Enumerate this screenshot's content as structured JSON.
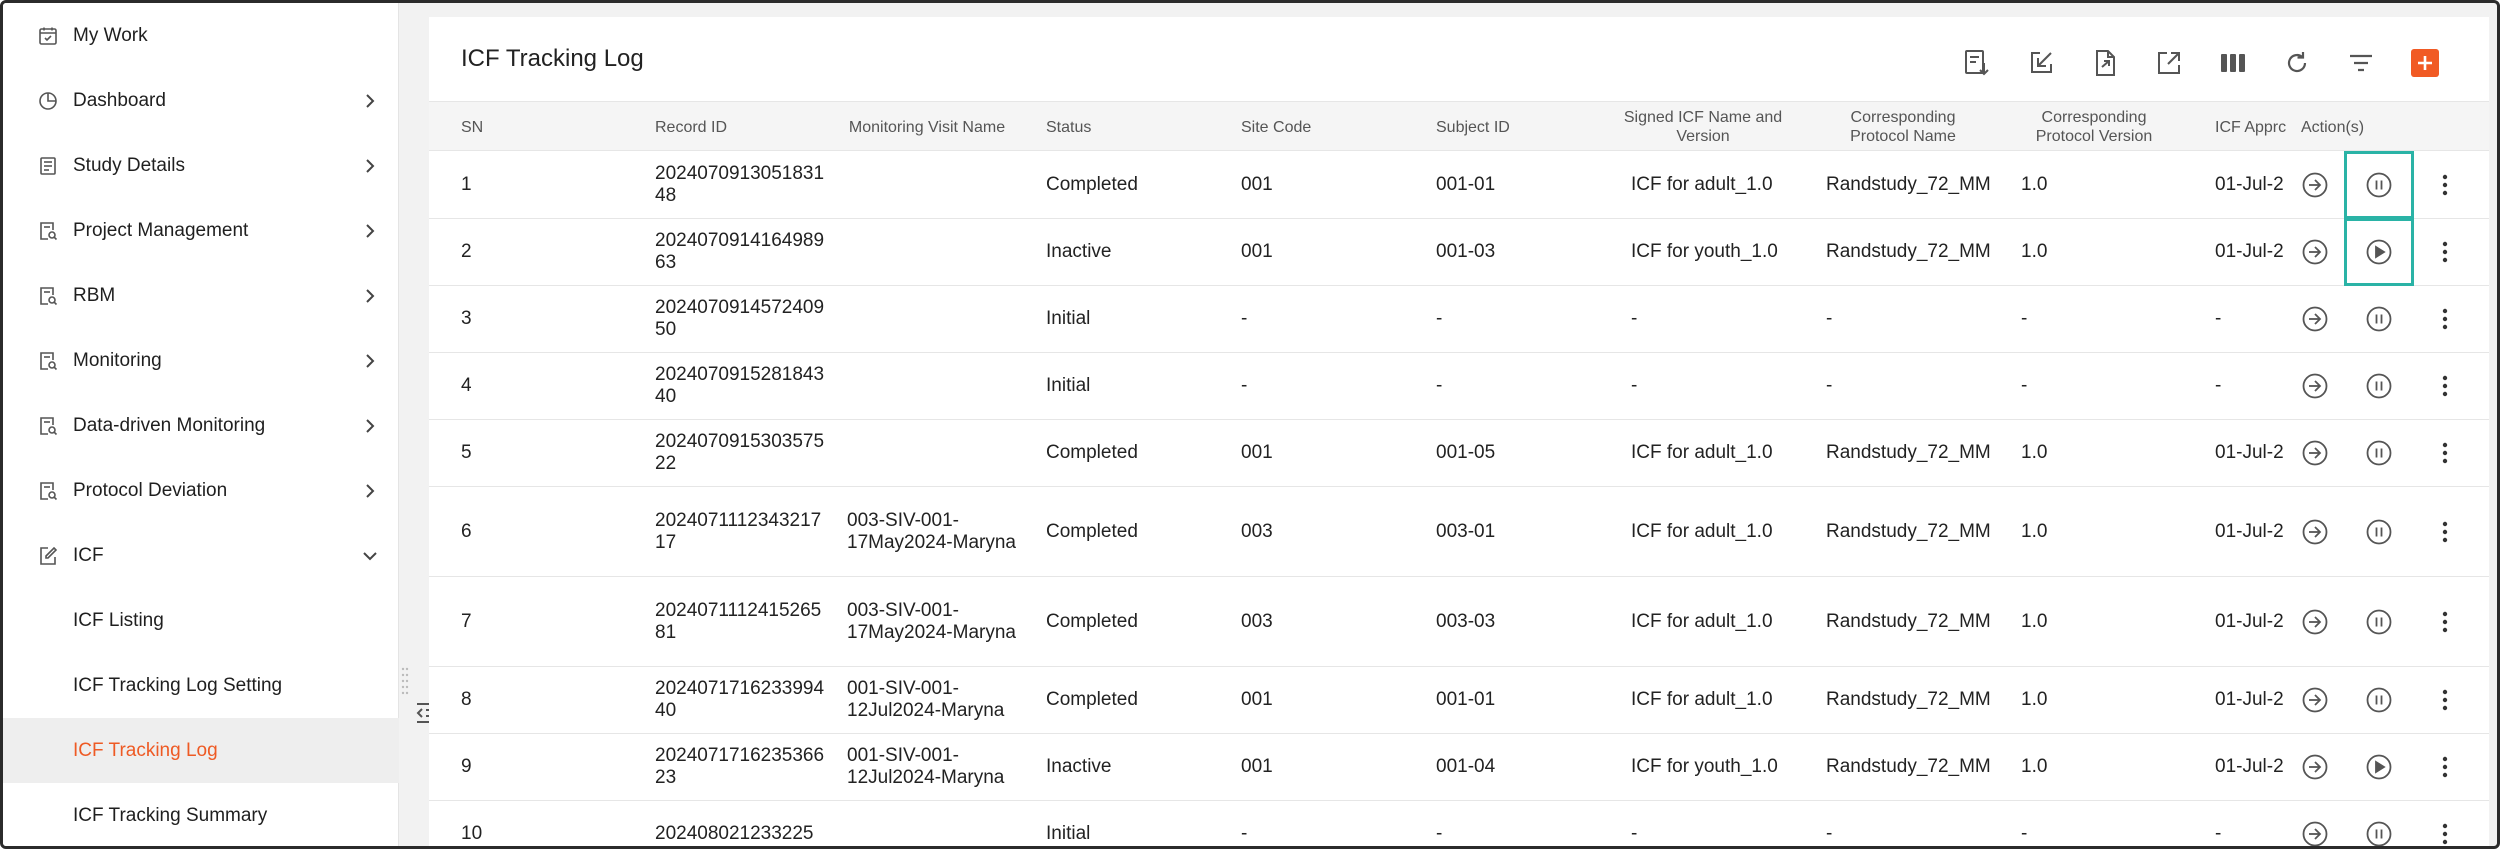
{
  "sidebar": {
    "items": [
      {
        "label": "My Work",
        "icon": "calendar-icon",
        "chevron": "none"
      },
      {
        "label": "Dashboard",
        "icon": "pie-chart-icon",
        "chevron": "right"
      },
      {
        "label": "Study Details",
        "icon": "document-list-icon",
        "chevron": "right"
      },
      {
        "label": "Project Management",
        "icon": "document-search-icon",
        "chevron": "right"
      },
      {
        "label": "RBM",
        "icon": "document-search-icon",
        "chevron": "right"
      },
      {
        "label": "Monitoring",
        "icon": "document-search-icon",
        "chevron": "right"
      },
      {
        "label": "Data-driven Monitoring",
        "icon": "document-search-icon",
        "chevron": "right"
      },
      {
        "label": "Protocol Deviation",
        "icon": "document-search-icon",
        "chevron": "right"
      },
      {
        "label": "ICF",
        "icon": "edit-document-icon",
        "chevron": "down"
      }
    ],
    "sub_items": [
      {
        "label": "ICF Listing",
        "active": false
      },
      {
        "label": "ICF Tracking Log Setting",
        "active": false
      },
      {
        "label": "ICF Tracking Log",
        "active": true
      },
      {
        "label": "ICF Tracking Summary",
        "active": false
      }
    ],
    "active_color": "#ee5a24"
  },
  "page": {
    "title": "ICF Tracking Log"
  },
  "toolbar": {
    "buttons": [
      "download-list-icon",
      "import-icon",
      "export-file-icon",
      "open-external-icon",
      "columns-icon",
      "refresh-icon",
      "filter-icon",
      "add-icon"
    ],
    "accent": "#f15a24"
  },
  "table": {
    "headers": {
      "sn": "SN",
      "record_id": "Record ID",
      "visit_name": "Monitoring Visit Name",
      "status": "Status",
      "site_code": "Site Code",
      "subject_id": "Subject ID",
      "icf_name": "Signed ICF Name and Version",
      "protocol_name": "Corresponding Protocol Name",
      "protocol_version": "Corresponding Protocol Version",
      "icf_approval": "ICF Apprc",
      "actions": "Action(s)"
    },
    "rows": [
      {
        "sn": "1",
        "record_id": "202407091305183148",
        "visit_name": "",
        "status": "Completed",
        "site_code": "001",
        "subject_id": "001-01",
        "icf_name": "ICF for adult_1.0",
        "protocol_name": "Randstudy_72_MM",
        "protocol_version": "1.0",
        "icf_approval": "01-Jul-2",
        "toggle": "pause"
      },
      {
        "sn": "2",
        "record_id": "202407091416498963",
        "visit_name": "",
        "status": "Inactive",
        "site_code": "001",
        "subject_id": "001-03",
        "icf_name": "ICF for youth_1.0",
        "protocol_name": "Randstudy_72_MM",
        "protocol_version": "1.0",
        "icf_approval": "01-Jul-2",
        "toggle": "play"
      },
      {
        "sn": "3",
        "record_id": "202407091457240950",
        "visit_name": "",
        "status": "Initial",
        "site_code": "-",
        "subject_id": "-",
        "icf_name": "-",
        "protocol_name": "-",
        "protocol_version": "-",
        "icf_approval": "-",
        "toggle": "pause"
      },
      {
        "sn": "4",
        "record_id": "202407091528184340",
        "visit_name": "",
        "status": "Initial",
        "site_code": "-",
        "subject_id": "-",
        "icf_name": "-",
        "protocol_name": "-",
        "protocol_version": "-",
        "icf_approval": "-",
        "toggle": "pause"
      },
      {
        "sn": "5",
        "record_id": "202407091530357522",
        "visit_name": "",
        "status": "Completed",
        "site_code": "001",
        "subject_id": "001-05",
        "icf_name": "ICF for adult_1.0",
        "protocol_name": "Randstudy_72_MM",
        "protocol_version": "1.0",
        "icf_approval": "01-Jul-2",
        "toggle": "pause"
      },
      {
        "sn": "6",
        "record_id": "202407111234321717",
        "visit_name": "003-SIV-001-17May2024-Maryna",
        "status": "Completed",
        "site_code": "003",
        "subject_id": "003-01",
        "icf_name": "ICF for adult_1.0",
        "protocol_name": "Randstudy_72_MM",
        "protocol_version": "1.0",
        "icf_approval": "01-Jul-2",
        "toggle": "pause"
      },
      {
        "sn": "7",
        "record_id": "202407111241526581",
        "visit_name": "003-SIV-001-17May2024-Maryna",
        "status": "Completed",
        "site_code": "003",
        "subject_id": "003-03",
        "icf_name": "ICF for adult_1.0",
        "protocol_name": "Randstudy_72_MM",
        "protocol_version": "1.0",
        "icf_approval": "01-Jul-2",
        "toggle": "pause"
      },
      {
        "sn": "8",
        "record_id": "202407171623399440",
        "visit_name": "001-SIV-001-12Jul2024-Maryna",
        "status": "Completed",
        "site_code": "001",
        "subject_id": "001-01",
        "icf_name": "ICF for adult_1.0",
        "protocol_name": "Randstudy_72_MM",
        "protocol_version": "1.0",
        "icf_approval": "01-Jul-2",
        "toggle": "pause"
      },
      {
        "sn": "9",
        "record_id": "202407171623536623",
        "visit_name": "001-SIV-001-12Jul2024-Maryna",
        "status": "Inactive",
        "site_code": "001",
        "subject_id": "001-04",
        "icf_name": "ICF for youth_1.0",
        "protocol_name": "Randstudy_72_MM",
        "protocol_version": "1.0",
        "icf_approval": "01-Jul-2",
        "toggle": "play"
      },
      {
        "sn": "10",
        "record_id": "202408021233225",
        "visit_name": "",
        "status": "Initial",
        "site_code": "-",
        "subject_id": "-",
        "icf_name": "-",
        "protocol_name": "-",
        "protocol_version": "-",
        "icf_approval": "-",
        "toggle": "pause"
      }
    ],
    "highlight_color": "#2ab3a6"
  }
}
